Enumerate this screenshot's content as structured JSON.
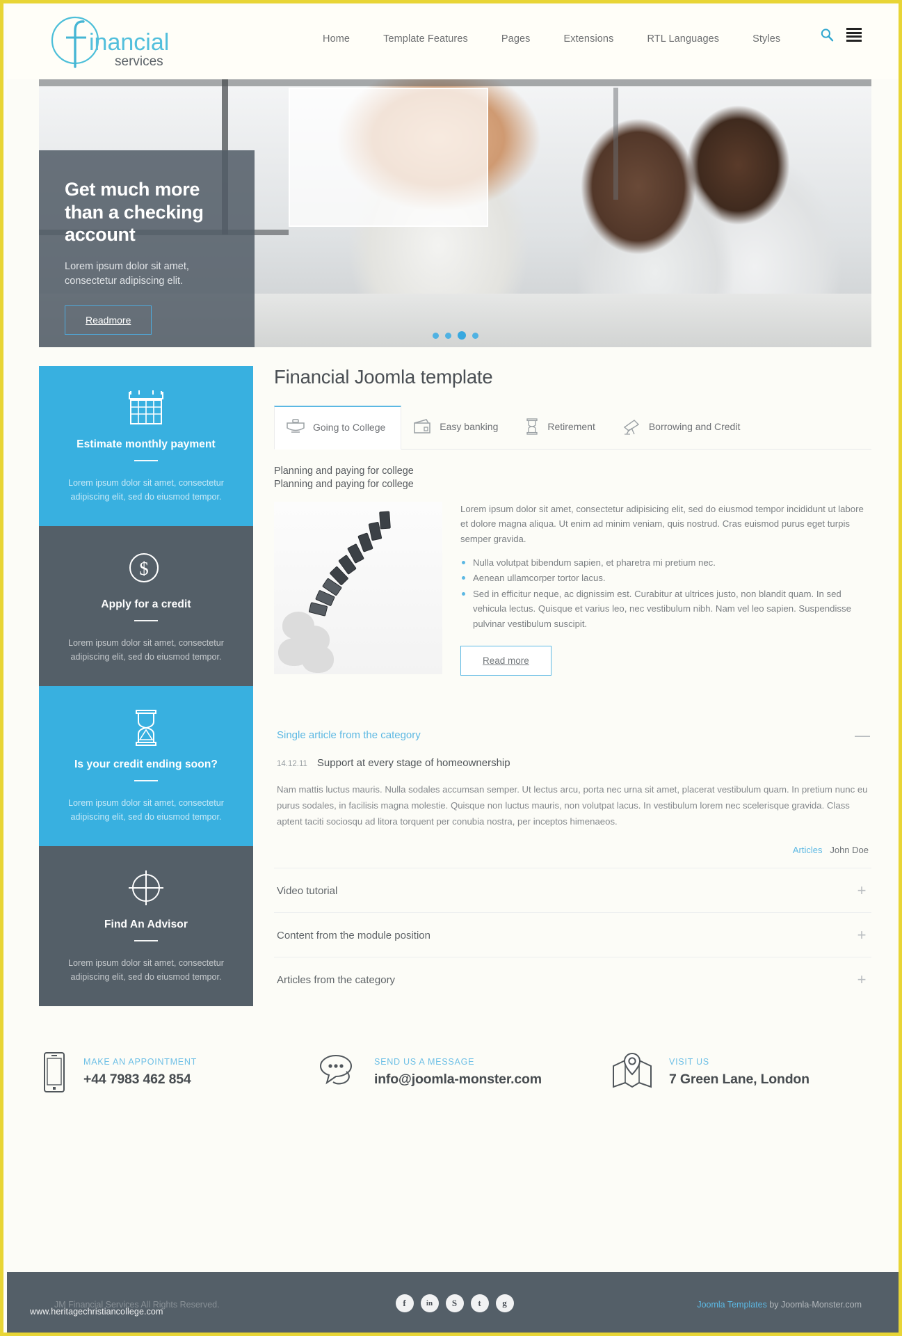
{
  "header": {
    "logo": {
      "brand": "financial",
      "sub": "services",
      "mark": "f-circle-logo"
    },
    "nav": [
      {
        "label": "Home"
      },
      {
        "label": "Template Features"
      },
      {
        "label": "Pages"
      },
      {
        "label": "Extensions"
      },
      {
        "label": "RTL Languages"
      },
      {
        "label": "Styles"
      }
    ],
    "icons": {
      "search": "search-icon",
      "menu": "hamburger-menu-icon"
    }
  },
  "hero": {
    "title": "Get much more than a checking account",
    "subtitle": "Lorem ipsum dolor sit amet, consectetur adipiscing elit.",
    "button": "Readmore",
    "slides": 4,
    "active_slide": 3
  },
  "sidebar": {
    "items": [
      {
        "icon": "calendar-icon",
        "title": "Estimate monthly payment",
        "text": "Lorem ipsum dolor sit amet, consectetur adipiscing elit, sed do eiusmod tempor.",
        "style": "blue"
      },
      {
        "icon": "dollar-coin-icon",
        "title": "Apply for a credit",
        "text": "Lorem ipsum dolor sit amet, consectetur adipiscing elit, sed do eiusmod tempor.",
        "style": "gray"
      },
      {
        "icon": "hourglass-icon",
        "title": "Is your credit ending soon?",
        "text": "Lorem ipsum dolor sit amet, consectetur adipiscing elit, sed do eiusmod tempor.",
        "style": "blue"
      },
      {
        "icon": "target-crosshair-icon",
        "title": "Find An Advisor",
        "text": "Lorem ipsum dolor sit amet, consectetur adipiscing elit, sed do eiusmod tempor.",
        "style": "gray"
      }
    ]
  },
  "main": {
    "title": "Financial Joomla template",
    "tabs": [
      {
        "label": "Going to College",
        "icon": "briefcase-icon",
        "active": true
      },
      {
        "label": "Easy banking",
        "icon": "wallet-icon",
        "active": false
      },
      {
        "label": "Retirement",
        "icon": "hourglass-icon",
        "active": false
      },
      {
        "label": "Borrowing and Credit",
        "icon": "telescope-icon",
        "active": false
      }
    ],
    "subtitle_line1": "Planning and paying for college",
    "subtitle_line2": "Planning and paying for college",
    "article": {
      "image": "falling-dominoes-image",
      "paragraph": "Lorem ipsum dolor sit amet, consectetur adipisicing elit, sed do eiusmod tempor incididunt ut labore et dolore magna aliqua. Ut enim ad minim veniam, quis nostrud. Cras euismod purus eget turpis semper gravida.",
      "bullets": [
        "Nulla volutpat bibendum sapien, et pharetra mi pretium nec.",
        "Aenean ullamcorper tortor lacus.",
        "Sed in efficitur neque, ac dignissim est. Curabitur at ultrices justo, non blandit quam. In sed vehicula lectus. Quisque et varius leo, nec vestibulum nibh. Nam vel leo sapien. Suspendisse pulvinar vestibulum suscipit."
      ],
      "read_more": "Read more"
    },
    "accordion": [
      {
        "title": "Single article from the category",
        "sign": "—",
        "open": true,
        "date": "14.12.11",
        "article_title": "Support at every stage of homeownership",
        "body": "Nam mattis luctus mauris. Nulla sodales accumsan semper. Ut lectus arcu, porta nec urna sit amet, placerat vestibulum quam. In pretium nunc eu purus sodales, in facilisis magna molestie. Quisque non luctus mauris, non volutpat lacus. In vestibulum lorem nec scelerisque gravida. Class aptent taciti sociosqu ad litora torquent per conubia nostra, per inceptos himenaeos.",
        "meta_category": "Articles",
        "meta_author": "John Doe"
      },
      {
        "title": "Video tutorial",
        "sign": "+",
        "open": false
      },
      {
        "title": "Content from the module position",
        "sign": "+",
        "open": false
      },
      {
        "title": "Articles from the category",
        "sign": "+",
        "open": false
      }
    ]
  },
  "contact": [
    {
      "icon": "mobile-phone-icon",
      "label": "MAKE AN APPOINTMENT",
      "value": "+44 7983 462 854"
    },
    {
      "icon": "speech-bubbles-icon",
      "label": "SEND US A MESSAGE",
      "value": "info@joomla-monster.com"
    },
    {
      "icon": "map-pin-icon",
      "label": "VISIT US",
      "value": "7 Green Lane, London"
    }
  ],
  "footer": {
    "copyright": "JM Financial Services All Rights Reserved.",
    "watermark": "www.heritagechristiancollege.com",
    "social": [
      {
        "name": "facebook-icon",
        "glyph": "f"
      },
      {
        "name": "linkedin-icon",
        "glyph": "in"
      },
      {
        "name": "skype-icon",
        "glyph": "S"
      },
      {
        "name": "twitter-icon",
        "glyph": "t"
      },
      {
        "name": "google-plus-icon",
        "glyph": "g"
      }
    ],
    "credit_link": "Joomla Templates",
    "credit_rest": " by Joomla-Monster.com"
  },
  "colors": {
    "accent_blue": "#38b0e0",
    "dark_slate": "#545f68",
    "frame_yellow": "#e8d536",
    "link_blue": "#5cb8e3"
  }
}
